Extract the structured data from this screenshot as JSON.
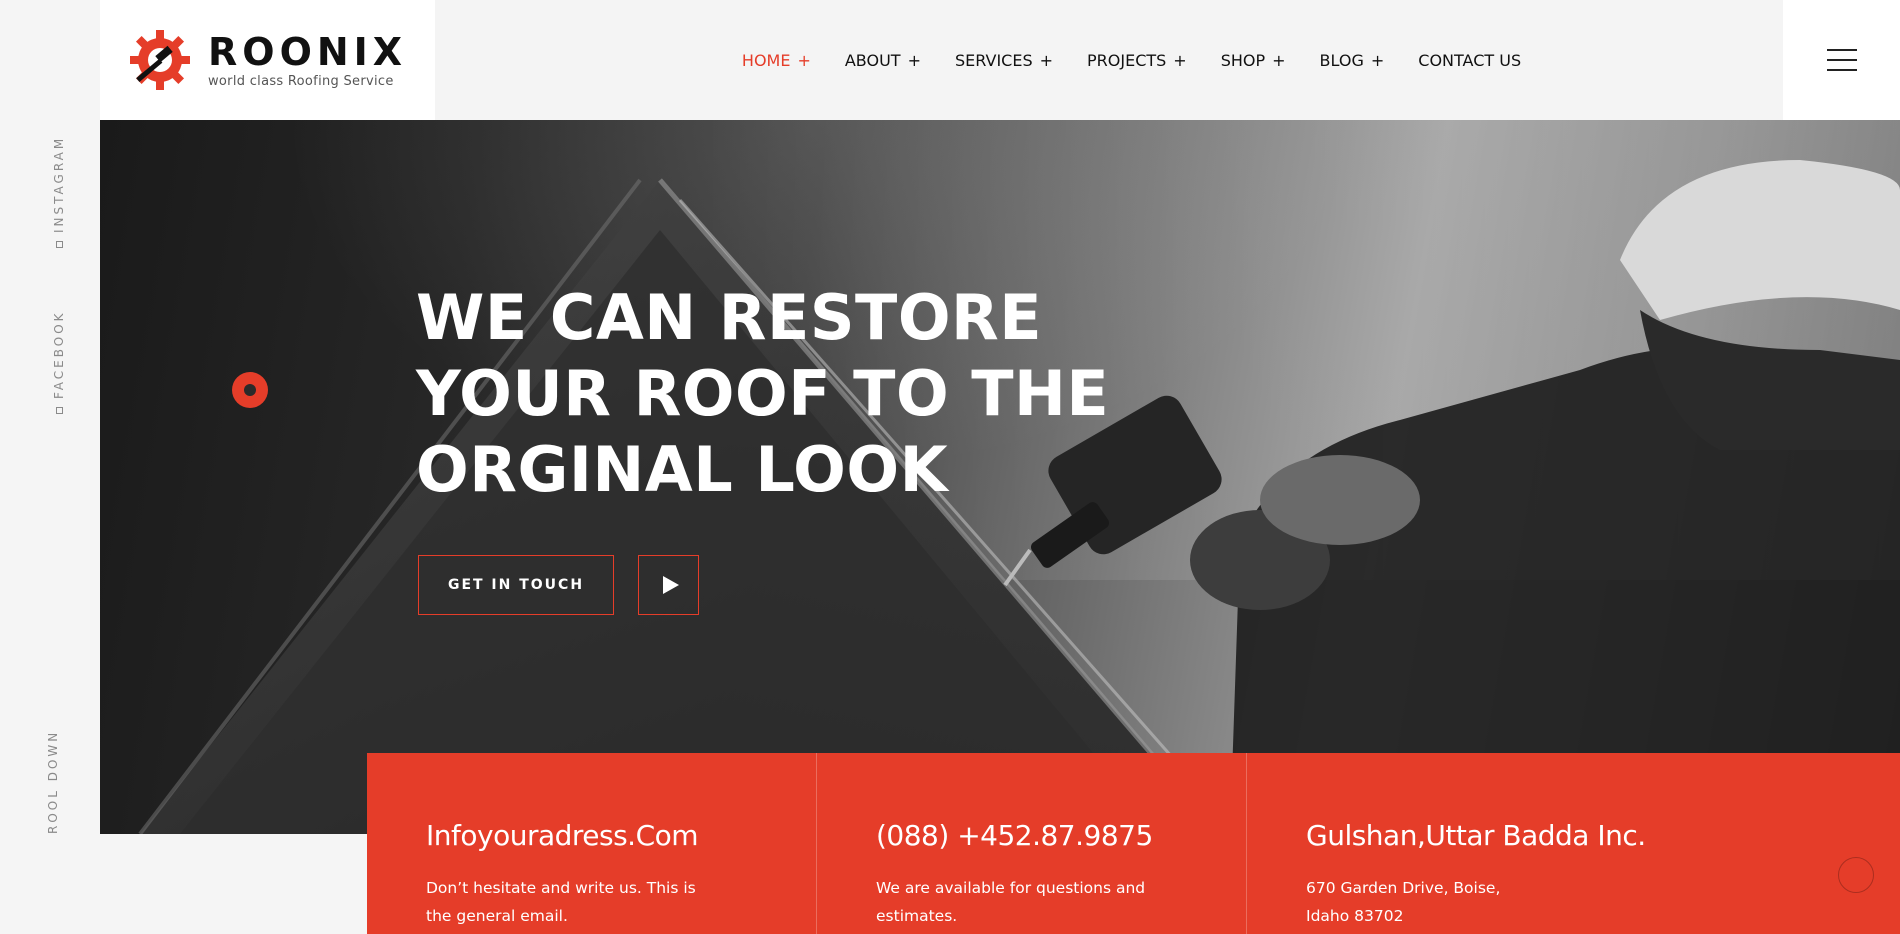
{
  "brand": {
    "name": "ROONIX",
    "tagline": "world class Roofing Service",
    "icon": "gear-hammer-logo",
    "accent_color": "#e53d29"
  },
  "nav": {
    "items": [
      {
        "label": "HOME",
        "suffix": "+",
        "active": true
      },
      {
        "label": "ABOUT",
        "suffix": "+"
      },
      {
        "label": "SERVICES",
        "suffix": "+"
      },
      {
        "label": "PROJECTS",
        "suffix": "+"
      },
      {
        "label": "SHOP",
        "suffix": "+"
      },
      {
        "label": "BLOG",
        "suffix": "+"
      },
      {
        "label": "CONTACT US",
        "suffix": ""
      }
    ],
    "menu_icon": "hamburger-icon"
  },
  "rail": {
    "instagram": "INSTAGRAM",
    "facebook": "FACEBOOK",
    "scroll": "ROOL DOWN"
  },
  "hero": {
    "title_lines": [
      "WE CAN RESTORE",
      "YOUR ROOF TO THE",
      "ORGINAL LOOK"
    ],
    "cta_label": "GET IN TOUCH",
    "play_icon": "play-icon"
  },
  "info": [
    {
      "heading": "Infoyouradress.Com",
      "text": "Don’t hesitate and write us. This is the general email."
    },
    {
      "heading": "(088) +452.87.9875",
      "text": "We are available for questions and estimates."
    },
    {
      "heading": "Gulshan,Uttar Badda Inc.",
      "text": "670 Garden Drive, Boise, Idaho 83702"
    }
  ]
}
